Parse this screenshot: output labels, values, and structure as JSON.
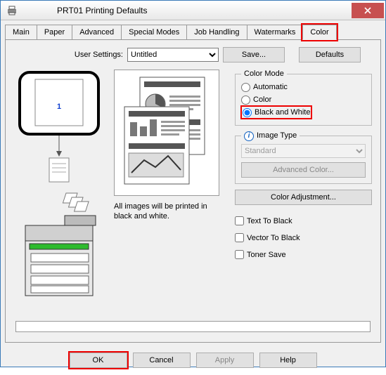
{
  "window": {
    "title": "PRT01 Printing Defaults"
  },
  "tabs": [
    "Main",
    "Paper",
    "Advanced",
    "Special Modes",
    "Job Handling",
    "Watermarks",
    "Color"
  ],
  "active_tab": "Color",
  "user_settings": {
    "label": "User Settings:",
    "value": "Untitled",
    "save_label": "Save...",
    "defaults_label": "Defaults"
  },
  "preview": {
    "page_number": "1",
    "description": "All images will be printed in black and white."
  },
  "color_mode": {
    "legend": "Color Mode",
    "options": [
      "Automatic",
      "Color",
      "Black and White"
    ],
    "selected": "Black and White"
  },
  "image_type": {
    "legend": "Image Type",
    "value": "Standard",
    "advanced_label": "Advanced Color..."
  },
  "color_adjust_label": "Color Adjustment...",
  "checks": {
    "text_to_black": "Text To Black",
    "vector_to_black": "Vector To Black",
    "toner_save": "Toner Save"
  },
  "buttons": {
    "ok": "OK",
    "cancel": "Cancel",
    "apply": "Apply",
    "help": "Help"
  }
}
